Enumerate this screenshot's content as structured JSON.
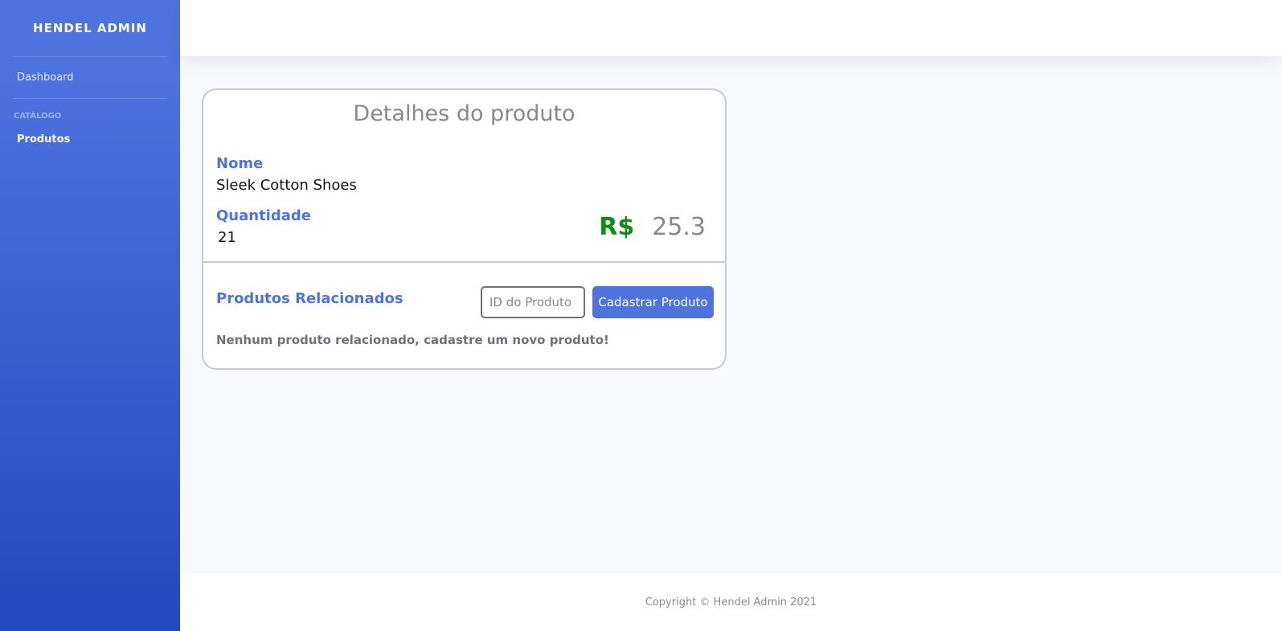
{
  "sidebar": {
    "brand": "HENDEL ADMIN",
    "dashboard_label": "Dashboard",
    "section_heading": "CATÁLOGO",
    "products_label": "Produtos"
  },
  "product_card": {
    "title": "Detalhes do produto",
    "name_label": "Nome",
    "name_value": "Sleek Cotton Shoes",
    "quantity_label": "Quantidade",
    "quantity_value": "21",
    "currency": "R$",
    "price": "25.3"
  },
  "related": {
    "title": "Produtos Relacionados",
    "id_placeholder": "ID do Produto",
    "id_value": "",
    "register_button": "Cadastrar Produto",
    "empty_message": "Nenhum produto relacionado, cadastre um novo produto!"
  },
  "footer": {
    "copyright": "Copyright © Hendel Admin 2021"
  },
  "colors": {
    "primary": "#4e73df",
    "price_currency": "#138a1a",
    "muted": "#858796"
  }
}
